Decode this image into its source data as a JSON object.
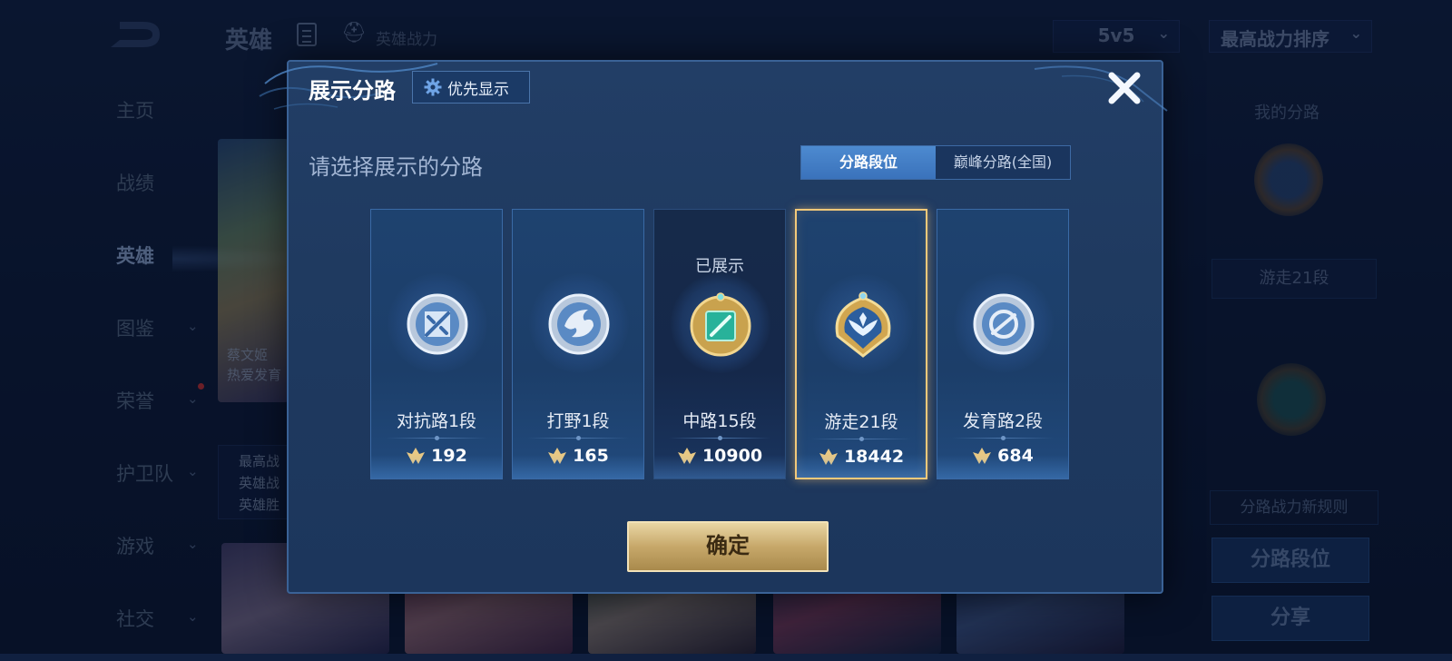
{
  "background": {
    "top_title": "英雄",
    "top_power_label": "英雄战力",
    "mode_dropdown": "5v5",
    "sort_dropdown": "最高战力排序",
    "nav": [
      {
        "label": "主页",
        "chevron": false
      },
      {
        "label": "战绩",
        "chevron": false
      },
      {
        "label": "英雄",
        "chevron": false,
        "active": true
      },
      {
        "label": "图鉴",
        "chevron": true
      },
      {
        "label": "荣誉",
        "chevron": true,
        "dot": true
      },
      {
        "label": "护卫队",
        "chevron": true
      },
      {
        "label": "游戏",
        "chevron": true
      },
      {
        "label": "社交",
        "chevron": true
      }
    ],
    "left_card_text1": "蔡文姬",
    "left_card_text2": "热爱发育",
    "left_panel_lines": [
      "最高战",
      "英雄战",
      "英雄胜"
    ],
    "right_panel": {
      "title": "我的分路",
      "current_lane": "游走21段",
      "rule_label": "分路战力新规则",
      "lane_rank_button": "分路段位",
      "share_button": "分享"
    }
  },
  "modal": {
    "title": "展示分路",
    "priority_button": "优先显示",
    "subtitle": "请选择展示的分路",
    "tabs": [
      {
        "label": "分路段位",
        "active": true
      },
      {
        "label": "巅峰分路(全国)",
        "active": false
      }
    ],
    "lanes": [
      {
        "name": "对抗路1段",
        "power": "192",
        "icon": "sword-emblem-icon",
        "shown_label": "",
        "selected": false,
        "dim": false
      },
      {
        "name": "打野1段",
        "power": "165",
        "icon": "claw-emblem-icon",
        "shown_label": "",
        "selected": false,
        "dim": false
      },
      {
        "name": "中路15段",
        "power": "10900",
        "icon": "wand-emblem-icon",
        "shown_label": "已展示",
        "selected": false,
        "dim": true
      },
      {
        "name": "游走21段",
        "power": "18442",
        "icon": "wings-emblem-icon",
        "shown_label": "",
        "selected": true,
        "dim": false
      },
      {
        "name": "发育路2段",
        "power": "684",
        "icon": "arrow-emblem-icon",
        "shown_label": "",
        "selected": false,
        "dim": false
      }
    ],
    "confirm_button": "确定"
  },
  "colors": {
    "selected_border": "#f3c97a",
    "confirm_gold": "#c7a86a",
    "tab_active": "#3a72bb"
  }
}
